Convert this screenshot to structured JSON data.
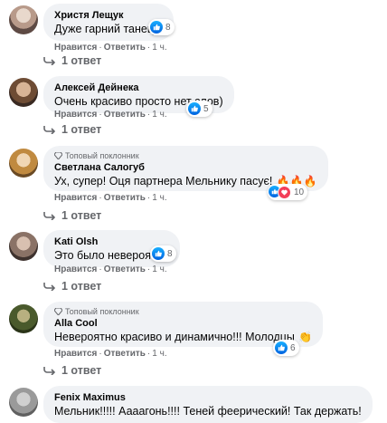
{
  "comments": [
    {
      "author": "Христя Лещук",
      "badge": "",
      "text": "Дуже гарний танець!",
      "reaction_count": "8",
      "like_label": "Нравится",
      "reply_label": "Ответить",
      "time": "1 ч.",
      "replies": "1 ответ",
      "avatar_color": "#c9b8b0"
    },
    {
      "author": "Алексей Дейнека",
      "badge": "",
      "text": "Очень красиво просто нет слов)",
      "reaction_count": "5",
      "like_label": "Нравится",
      "reply_label": "Ответить",
      "time": "1 ч.",
      "replies": "1 ответ",
      "avatar_color": "#8a6a4e"
    },
    {
      "author": "Светлана Салогуб",
      "badge": "Топовый поклонник",
      "text": "Ух, супер! Оця партнера Мельнику пасує!",
      "emoji": "🔥🔥🔥",
      "reaction_count": "10",
      "like_label": "Нравится",
      "reply_label": "Ответить",
      "time": "1 ч.",
      "replies": "1 ответ",
      "avatar_color": "#c79a54"
    },
    {
      "author": "Kati Olsh",
      "badge": "",
      "text": "Это было невероятно",
      "reaction_count": "8",
      "like_label": "Нравится",
      "reply_label": "Ответить",
      "time": "1 ч.",
      "replies": "1 ответ",
      "avatar_color": "#7e6a60"
    },
    {
      "author": "Alla Cool",
      "badge": "Топовый поклонник",
      "text": "Невероятно красиво и динамично!!! Молодцы",
      "emoji": "👏",
      "reaction_count": "6",
      "like_label": "Нравится",
      "reply_label": "Ответить",
      "time": "1 ч.",
      "replies": "1 ответ",
      "avatar_color": "#4a5a2c"
    },
    {
      "author": "Fenix Maximus",
      "badge": "",
      "text": "Мельник!!!!! Аааагонь!!!! Теней феерический! Так держать!",
      "avatar_color": "#9a9a9a"
    }
  ],
  "colors": {
    "bubble": "#f0f2f5",
    "secondary_text": "#65676b",
    "like_blue": "#1877f2"
  }
}
